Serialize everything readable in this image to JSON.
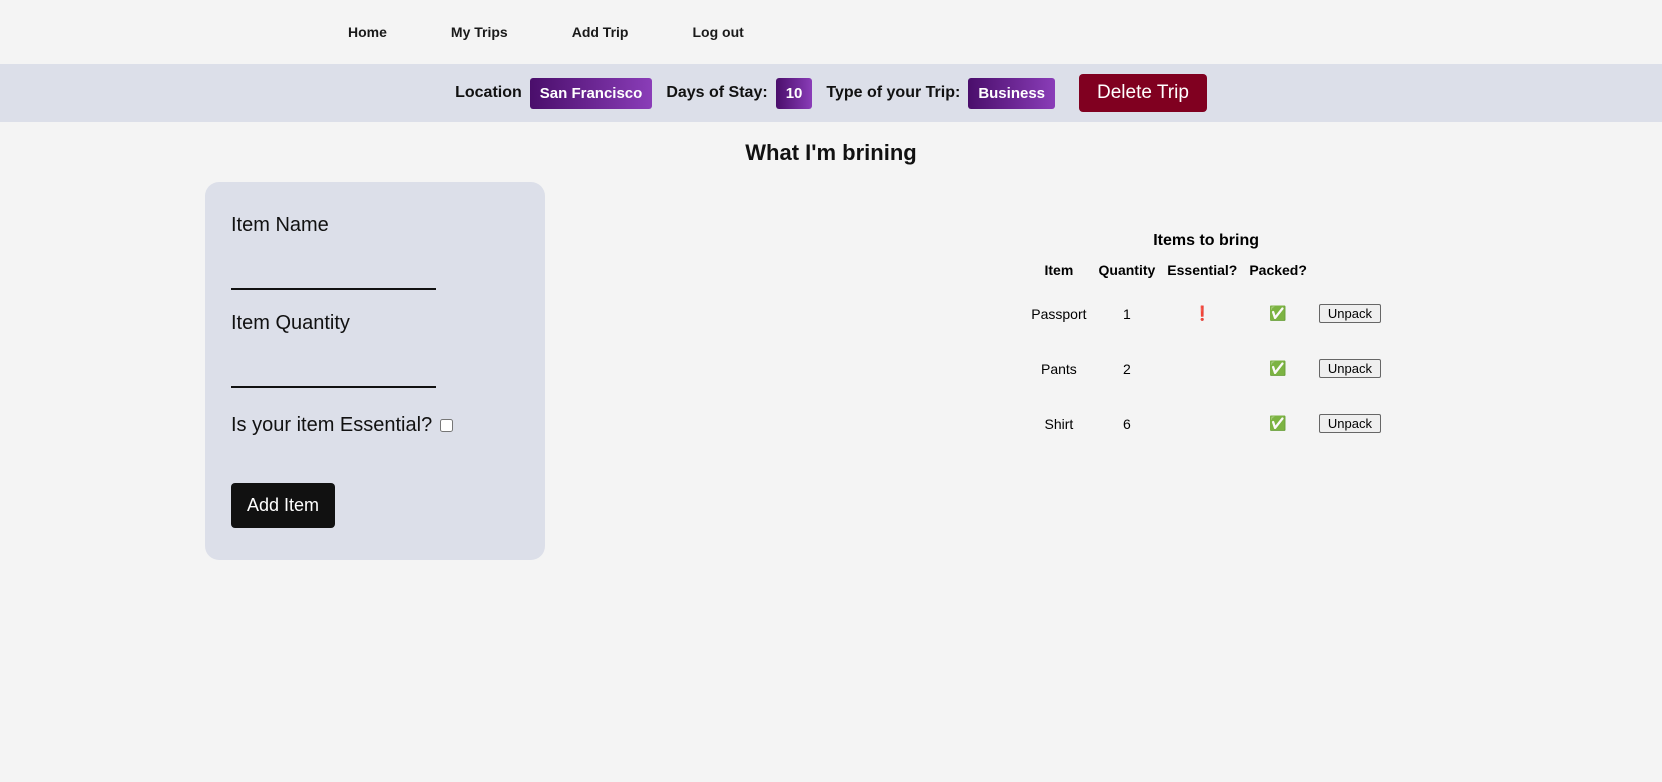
{
  "nav": {
    "items": [
      "Home",
      "My Trips",
      "Add Trip",
      "Log out"
    ]
  },
  "trip_bar": {
    "location_label": "Location",
    "location_value": "San Francisco",
    "days_label": "Days of Stay:",
    "days_value": "10",
    "type_label": "Type of your Trip:",
    "type_value": "Business",
    "delete_label": "Delete Trip"
  },
  "page_title": "What I'm brining",
  "form": {
    "item_name_label": "Item Name",
    "item_quantity_label": "Item Quantity",
    "essential_label": "Is your item Essential?",
    "add_button": "Add Item"
  },
  "items_section": {
    "title": "Items to bring",
    "headers": {
      "item": "Item",
      "quantity": "Quantity",
      "essential": "Essential?",
      "packed": "Packed?"
    },
    "unpack_label": "Unpack",
    "rows": [
      {
        "item": "Passport",
        "quantity": "1",
        "essential": "❗",
        "packed": "✅"
      },
      {
        "item": "Pants",
        "quantity": "2",
        "essential": "",
        "packed": "✅"
      },
      {
        "item": "Shirt",
        "quantity": "6",
        "essential": "",
        "packed": "✅"
      }
    ]
  }
}
